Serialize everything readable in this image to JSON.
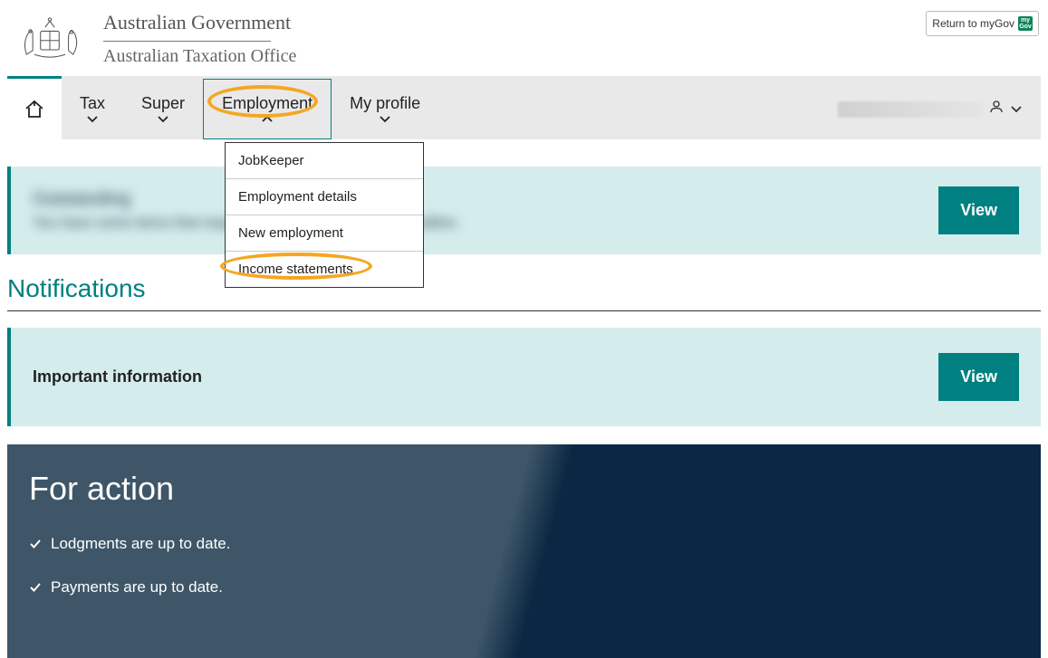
{
  "header": {
    "gov_line": "Australian Government",
    "ato_line": "Australian Taxation Office",
    "mygov_label": "Return to myGov",
    "mygov_badge": "my\nGov"
  },
  "nav": {
    "tax": "Tax",
    "super": "Super",
    "employment": "Employment",
    "myprofile": "My profile"
  },
  "dropdown": {
    "items": [
      {
        "label": "JobKeeper"
      },
      {
        "label": "Employment details"
      },
      {
        "label": "New employment"
      },
      {
        "label": "Income statements"
      }
    ]
  },
  "banner1": {
    "title": "Outstanding",
    "subtitle": "You have some items that require your attention before a deadline.",
    "view": "View"
  },
  "notifications_title": "Notifications",
  "info_banner": {
    "text": "Important information",
    "view": "View"
  },
  "for_action": {
    "title": "For action",
    "items": [
      "Lodgments are up to date.",
      "Payments are up to date."
    ]
  }
}
